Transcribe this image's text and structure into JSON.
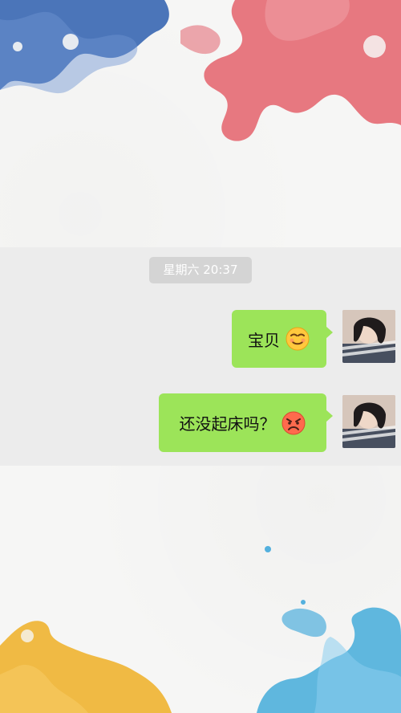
{
  "chat": {
    "timestamp": "星期六 20:37",
    "messages": [
      {
        "text": "宝贝",
        "emoji": "smug-face-icon"
      },
      {
        "text": "还没起床吗？",
        "emoji": "angry-face-icon"
      }
    ]
  },
  "colors": {
    "bubble": "#9ce459",
    "band": "#ececec",
    "timestamp_bg": "#d4d4d4"
  }
}
